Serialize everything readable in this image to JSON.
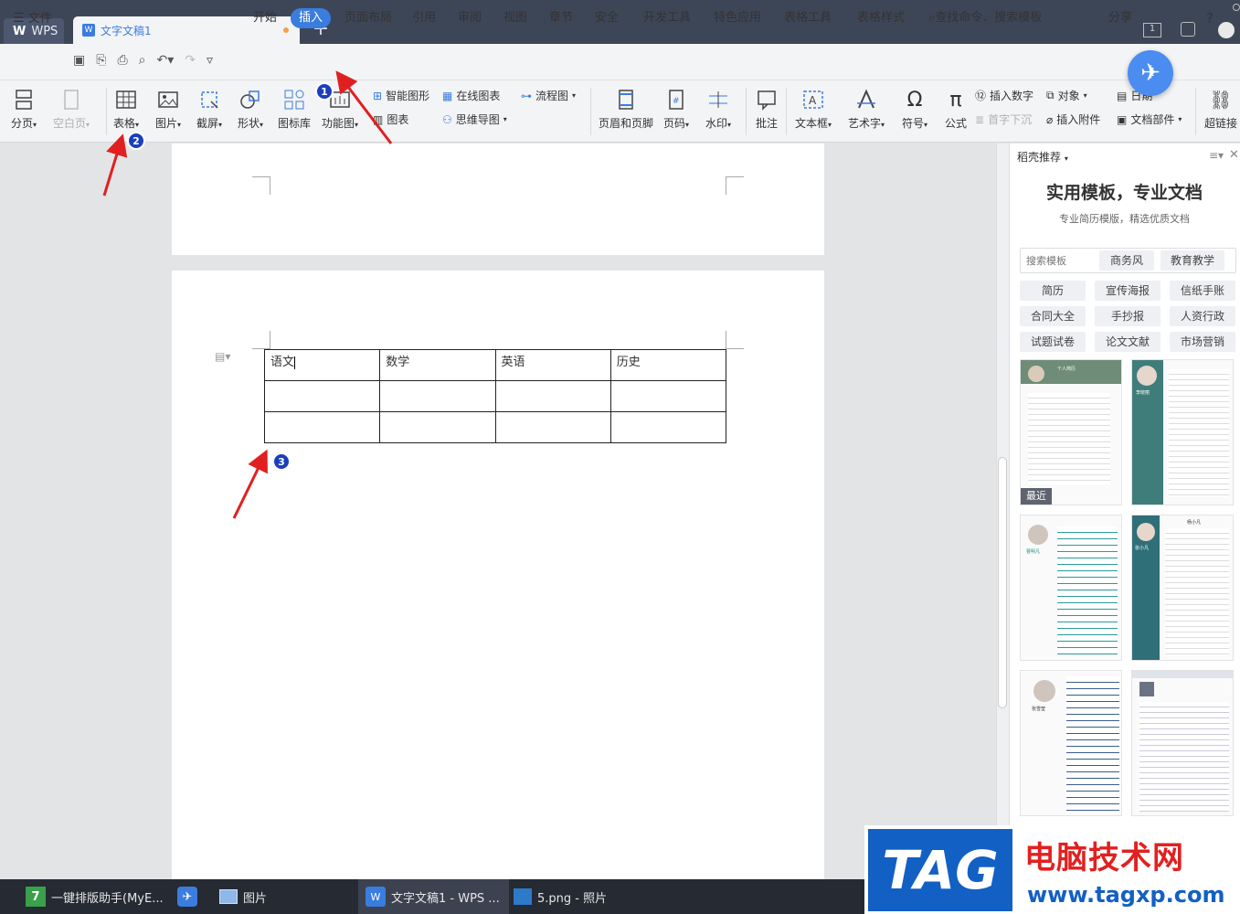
{
  "titlebar": {
    "app_tab": "WPS",
    "doc_tab": "文字文稿1",
    "new_tab": "+"
  },
  "menubar": {
    "file": "文件",
    "items": [
      "开始",
      "插入",
      "页面布局",
      "引用",
      "审阅",
      "视图",
      "章节",
      "安全",
      "开发工具",
      "特色应用",
      "表格工具",
      "表格样式"
    ],
    "active": "插入",
    "search": "查找命令、搜索模板",
    "share": "分享",
    "help": "?"
  },
  "ribbon": {
    "big": [
      {
        "label": "分页",
        "drop": "▾"
      },
      {
        "label": "空白页",
        "drop": "▾",
        "disabled": true
      },
      {
        "label": "表格",
        "drop": "▾"
      },
      {
        "label": "图片",
        "drop": "▾"
      },
      {
        "label": "截屏",
        "drop": "▾"
      },
      {
        "label": "形状",
        "drop": "▾"
      },
      {
        "label": "图标库"
      },
      {
        "label": "功能图",
        "drop": "▾"
      },
      {
        "label": "页眉和页脚"
      },
      {
        "label": "页码",
        "drop": "▾"
      },
      {
        "label": "水印",
        "drop": "▾"
      },
      {
        "label": "批注"
      },
      {
        "label": "文本框",
        "drop": "▾"
      },
      {
        "label": "艺术字",
        "drop": "▾"
      },
      {
        "label": "符号",
        "drop": "▾"
      },
      {
        "label": "公式"
      },
      {
        "label": "超链接"
      }
    ],
    "small": [
      "智能图形",
      "图表",
      "在线图表",
      "思维导图",
      "流程图",
      "插入数字",
      "首字下沉",
      "对象",
      "插入附件",
      "日期",
      "文档部件"
    ]
  },
  "document": {
    "table": [
      [
        "语文",
        "数学",
        "英语",
        "历史"
      ],
      [
        "",
        "",
        "",
        ""
      ],
      [
        "",
        "",
        "",
        ""
      ]
    ]
  },
  "annotations": [
    "1",
    "2",
    "3"
  ],
  "panel": {
    "title": "稻壳推荐",
    "headline": "实用模板，专业文档",
    "subline": "专业简历模版，精选优质文档",
    "search_placeholder": "搜索模板",
    "chips_top": [
      "商务风",
      "教育教学"
    ],
    "chips": [
      "简历",
      "宣传海报",
      "信纸手账",
      "合同大全",
      "手抄报",
      "人资行政",
      "试题试卷",
      "论文文献",
      "市场营销"
    ],
    "recent_badge": "最近",
    "resume_names": [
      "个人简历",
      "李晓丽",
      "曹明凡",
      "张小凡",
      "杨小凡",
      "张雪莹"
    ]
  },
  "taskbar": {
    "items": [
      "一键排版助手(MyE...",
      "",
      "图片",
      "文字文稿1 - WPS ...",
      "5.png - 照片"
    ]
  },
  "watermark": {
    "tag": "TAG",
    "title": "电脑技术网",
    "url": "www.tagxp.com"
  },
  "colors": {
    "accent": "#3a7dde",
    "titlebar": "#3d4657",
    "arrow": "#e02020",
    "badge": "#1a3fbd"
  }
}
